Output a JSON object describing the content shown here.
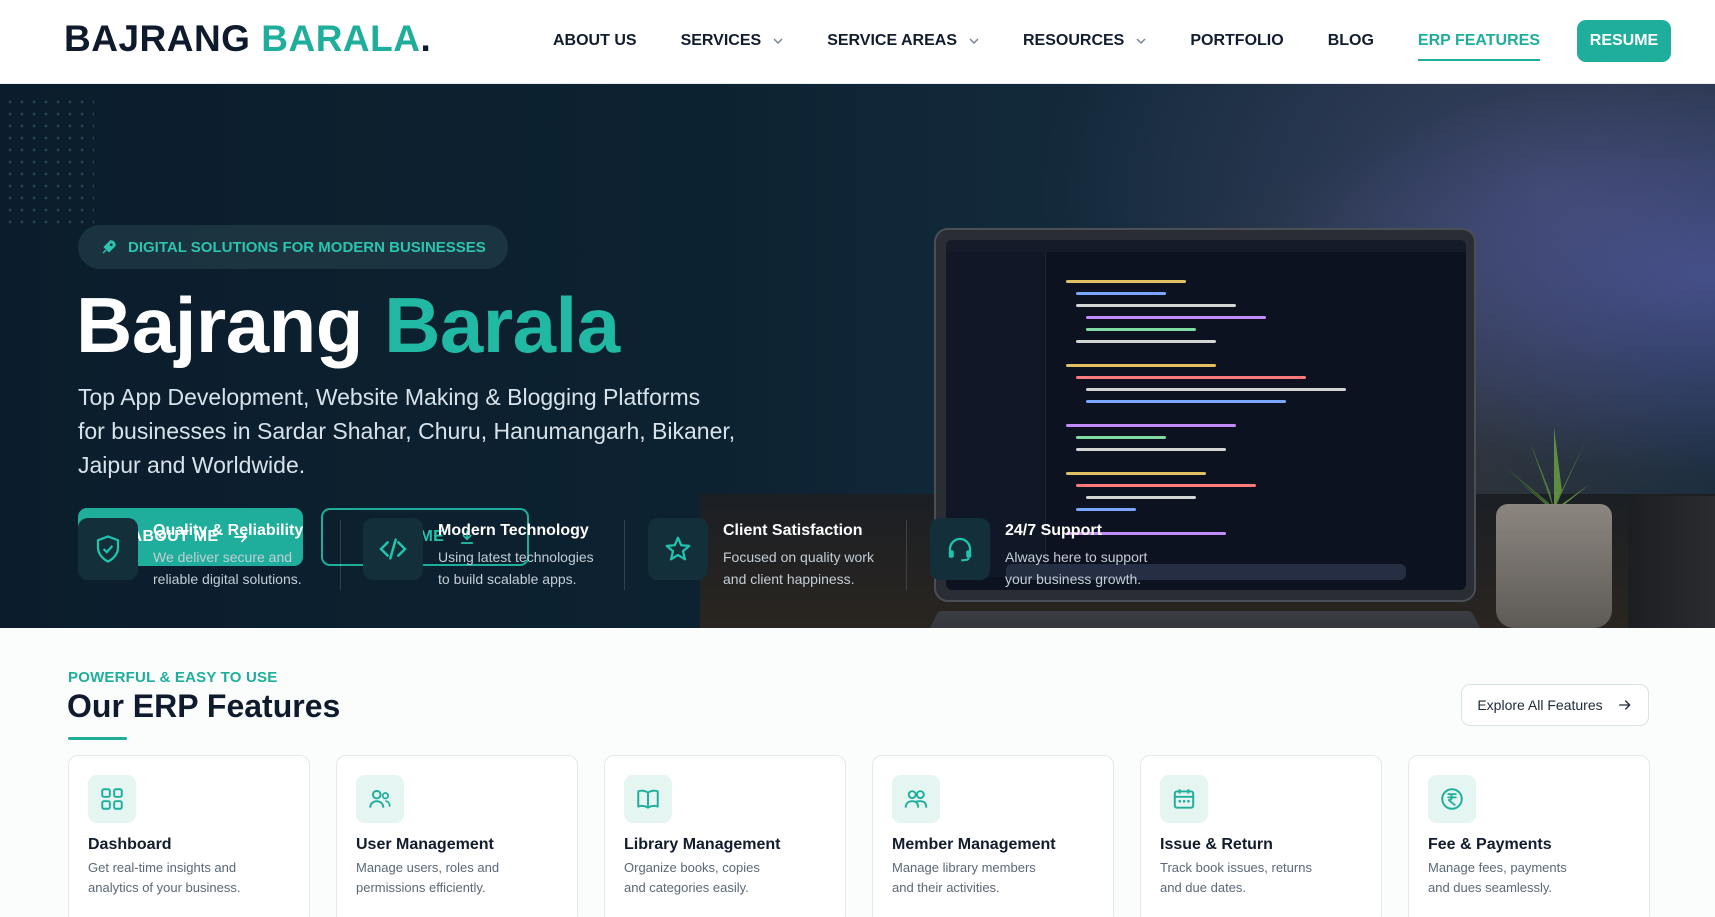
{
  "brand": {
    "name_part1": "BAJRANG",
    "name_part2": "BARALA",
    "dot": ".",
    "accent_color": "#1fae9b"
  },
  "nav": {
    "items": [
      {
        "label": "ABOUT US",
        "dropdown": false
      },
      {
        "label": "SERVICES",
        "dropdown": true
      },
      {
        "label": "SERVICE AREAS",
        "dropdown": true
      },
      {
        "label": "RESOURCES",
        "dropdown": true
      },
      {
        "label": "PORTFOLIO",
        "dropdown": false
      },
      {
        "label": "BLOG",
        "dropdown": false
      },
      {
        "label": "ERP FEATURES",
        "dropdown": false,
        "active": true
      }
    ],
    "cta_label": "RESUME"
  },
  "hero": {
    "badge": "DIGITAL SOLUTIONS FOR MODERN BUSINESSES",
    "badge_icon": "rocket-icon",
    "title_part1": "Bajrang",
    "title_part2": "Barala",
    "subtitle_lines": [
      "Top App Development, Website Making & Blogging Platforms",
      "for businesses in Sardar Shahar, Churu, Hanumangarh, Bikaner,",
      "Jaipur and Worldwide."
    ],
    "primary_button": "ABOUT ME",
    "secondary_button": "RESUME",
    "features": [
      {
        "icon": "shield-check-icon",
        "title": "Quality & Reliability",
        "desc": [
          "We deliver secure and",
          "reliable digital solutions."
        ]
      },
      {
        "icon": "code-icon",
        "title": "Modern Technology",
        "desc": [
          "Using latest technologies",
          "to build scalable apps."
        ]
      },
      {
        "icon": "star-icon",
        "title": "Client Satisfaction",
        "desc": [
          "Focused on quality work",
          "and client happiness."
        ]
      },
      {
        "icon": "headset-icon",
        "title": "24/7 Support",
        "desc": [
          "Always here to support",
          "your business growth."
        ]
      }
    ]
  },
  "erp": {
    "kicker": "POWERFUL & EASY TO USE",
    "title": "Our ERP Features",
    "explore_label": "Explore All Features",
    "cards": [
      {
        "icon": "dashboard-grid-icon",
        "title": "Dashboard",
        "desc": [
          "Get real-time insights and",
          "analytics of your business."
        ]
      },
      {
        "icon": "users-icon",
        "title": "User Management",
        "desc": [
          "Manage users, roles and",
          "permissions efficiently."
        ]
      },
      {
        "icon": "book-open-icon",
        "title": "Library Management",
        "desc": [
          "Organize books, copies",
          "and categories easily."
        ]
      },
      {
        "icon": "members-icon",
        "title": "Member Management",
        "desc": [
          "Manage library members",
          "and their activities."
        ]
      },
      {
        "icon": "calendar-icon",
        "title": "Issue & Return",
        "desc": [
          "Track book issues, returns",
          "and due dates."
        ]
      },
      {
        "icon": "rupee-icon",
        "title": "Fee & Payments",
        "desc": [
          "Manage fees, payments",
          "and dues seamlessly."
        ]
      }
    ]
  }
}
